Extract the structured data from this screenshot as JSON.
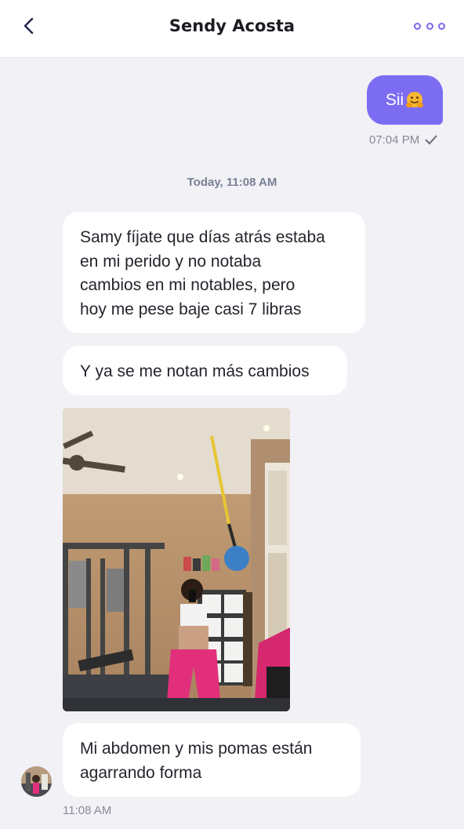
{
  "header": {
    "title": "Sendy Acosta",
    "back_icon": "chevron-left-icon",
    "more_icon": "more-horizontal-icon"
  },
  "outgoing": {
    "text": "Sii",
    "emoji": "hugging-face-emoji",
    "time": "07:04 PM",
    "status_icon": "check-icon"
  },
  "date_separator": "Today, 11:08 AM",
  "incoming": {
    "messages": [
      {
        "line1": "Samy fíjate que días atrás estaba",
        "line2": "en mi perido y no notaba",
        "line3": "cambios en mi notables, pero",
        "line4": "hoy me pese baje casi 7 libras"
      },
      {
        "line1": "Y ya se me notan más cambios"
      },
      {
        "line1": "Mi abdomen y mis pomas están",
        "line2": "agarrando forma"
      }
    ],
    "time": "11:08 AM"
  },
  "colors": {
    "accent": "#7c6cf2",
    "background": "#f1f1f6",
    "bubble_in": "#ffffff"
  }
}
